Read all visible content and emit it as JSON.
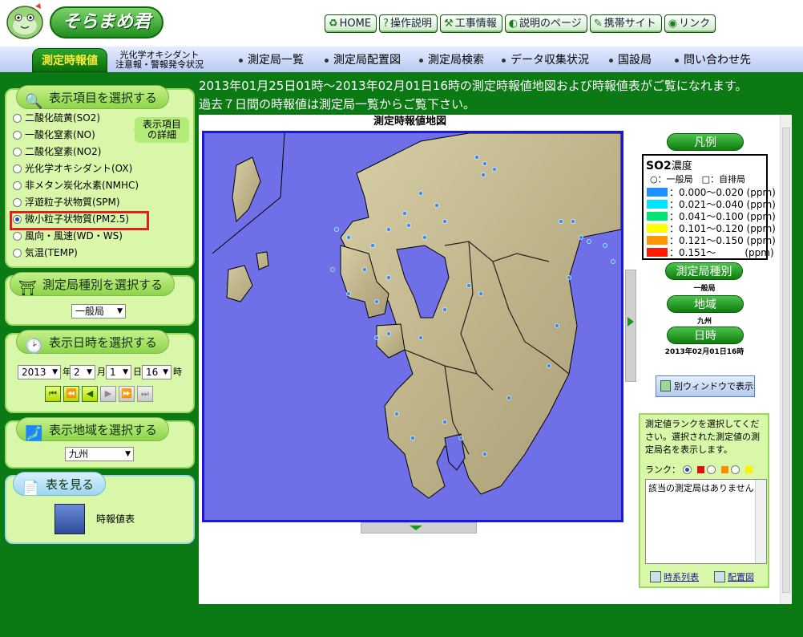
{
  "header": {
    "logo_text": "そらまめ君",
    "nav": [
      {
        "label": "HOME",
        "icon": "recycle-icon",
        "glyph": "♻"
      },
      {
        "label": "操作説明",
        "icon": "help-icon",
        "glyph": "?"
      },
      {
        "label": "工事情報",
        "icon": "construction-icon",
        "glyph": "⚒"
      },
      {
        "label": "説明のページ",
        "icon": "book-icon",
        "glyph": "◐"
      },
      {
        "label": "携帯サイト",
        "icon": "pen-icon",
        "glyph": "✎"
      },
      {
        "label": "リンク",
        "icon": "globe-icon",
        "glyph": "◉"
      }
    ]
  },
  "menu": {
    "active": "測定時報値",
    "ox_line1": "光化学オキシダント",
    "ox_line2": "注意報・警報発令状況",
    "items": [
      "測定局一覧",
      "測定局配置図",
      "測定局検索",
      "データ収集状況",
      "国設局",
      "問い合わせ先"
    ]
  },
  "panels": {
    "items": {
      "title": "表示項目を選択する",
      "detail_tip_line1": "表示項目",
      "detail_tip_line2": "の詳細",
      "options": [
        {
          "label": "二酸化硫黄(SO2)",
          "checked": false
        },
        {
          "label": "一酸化窒素(NO)",
          "checked": false
        },
        {
          "label": "二酸化窒素(NO2)",
          "checked": false
        },
        {
          "label": "光化学オキシダント(OX)",
          "checked": false
        },
        {
          "label": "非メタン炭化水素(NMHC)",
          "checked": false
        },
        {
          "label": "浮遊粒子状物質(SPM)",
          "checked": false
        },
        {
          "label": "微小粒子状物質(PM2.5)",
          "checked": true
        },
        {
          "label": "風向・風速(WD・WS)",
          "checked": false
        },
        {
          "label": "気温(TEMP)",
          "checked": false
        }
      ]
    },
    "station_type": {
      "title": "測定局種別を選択する",
      "value": "一般局"
    },
    "datetime": {
      "title": "表示日時を選択する",
      "year": "2013",
      "year_unit": "年",
      "month": "2",
      "month_unit": "月",
      "day": "1",
      "day_unit": "日",
      "hour": "16",
      "hour_unit": "時",
      "buttons": [
        "⏮",
        "⏪",
        "◀",
        "▶",
        "⏩",
        "⏭"
      ]
    },
    "region": {
      "title": "表示地域を選択する",
      "value": "九州"
    },
    "table": {
      "title": "表を見る",
      "link": "時報値表"
    }
  },
  "intro": {
    "line1": "2013年01月25日01時～2013年02月01日16時の測定時報値地図および時報値表がご覧になれます。",
    "line2": "過去７日間の時報値は測定局一覧からご覧下さい。"
  },
  "map": {
    "title": "測定時報値地図"
  },
  "legend": {
    "pill": "凡例",
    "title": "SO2",
    "title_suffix": "濃度",
    "subtitle": "○：一般局　□：自排局",
    "rows": [
      {
        "label": "：0.000～0.020 (ppm)",
        "color": "#1e90ff"
      },
      {
        "label": "：0.021～0.040 (ppm)",
        "color": "#00e5ff"
      },
      {
        "label": "：0.041～0.100 (ppm)",
        "color": "#00e676"
      },
      {
        "label": "：0.101～0.120 (ppm)",
        "color": "#ffff00"
      },
      {
        "label": "：0.121～0.150 (ppm)",
        "color": "#ff9800"
      },
      {
        "label": "：0.151～　　　(ppm)",
        "color": "#ff1a00"
      }
    ]
  },
  "info": {
    "station_type_pill": "測定局種別",
    "station_type_value": "一般局",
    "region_pill": "地域",
    "region_value": "九州",
    "datetime_pill": "日時",
    "datetime_value": "2013年02月01日16時",
    "popup_button": "別ウィンドウで表示"
  },
  "rank": {
    "description": "測定値ランクを選択してください。選択された測定値の測定局名を表示します。",
    "label": "ランク：",
    "result": "該当の測定局はありません",
    "timeseries_link": "時系列表",
    "placement_link": "配置図"
  }
}
